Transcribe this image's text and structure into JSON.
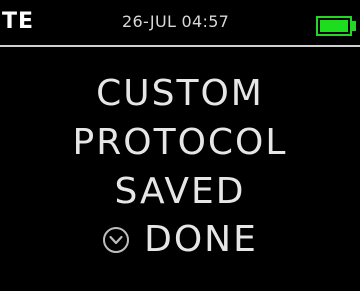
{
  "status_bar": {
    "mode": "TE",
    "datetime": "26-JUL 04:57",
    "battery_level": 1.0,
    "battery_color": "#1edc1e"
  },
  "message": {
    "line1": "CUSTOM",
    "line2": "PROTOCOL",
    "line3": "SAVED"
  },
  "done": {
    "icon": "circle-down-icon",
    "label": "DONE"
  }
}
